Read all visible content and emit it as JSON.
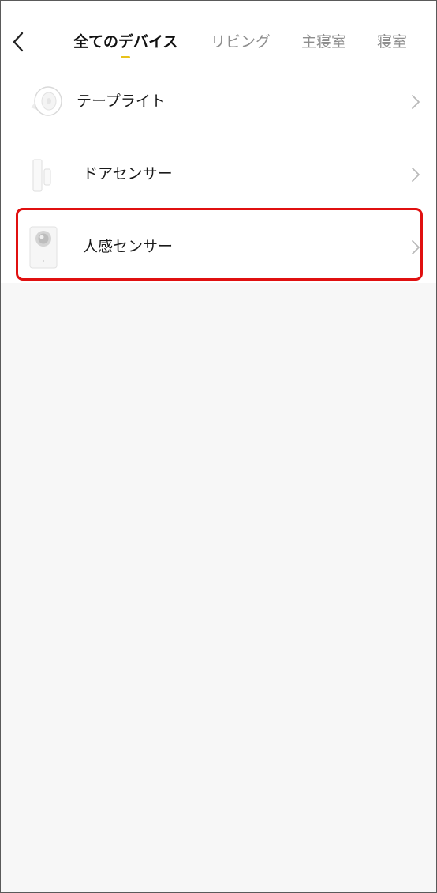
{
  "header": {
    "back_icon": "chevron-left-icon",
    "tabs": [
      {
        "label": "全てのデバイス",
        "active": true
      },
      {
        "label": "リビング",
        "active": false
      },
      {
        "label": "主寝室",
        "active": false
      },
      {
        "label": "寝室",
        "active": false
      }
    ],
    "indicator_color": "#e8c21a"
  },
  "devices": [
    {
      "name": "テープライト",
      "icon": "tape-light-icon",
      "chevron": "chevron-right-icon"
    },
    {
      "name": "ドアセンサー",
      "icon": "door-sensor-icon",
      "chevron": "chevron-right-icon"
    },
    {
      "name": "人感センサー",
      "icon": "motion-sensor-icon",
      "chevron": "chevron-right-icon",
      "highlighted": true
    }
  ],
  "highlight_color": "#e01010"
}
